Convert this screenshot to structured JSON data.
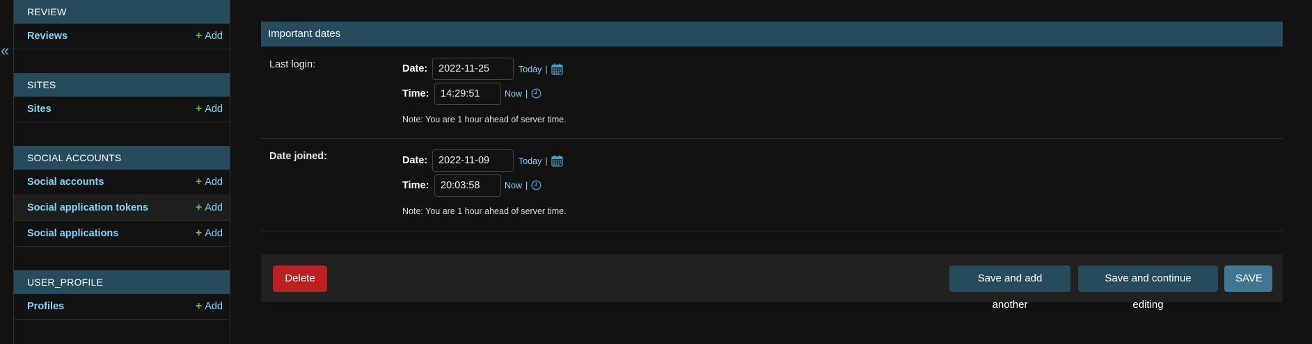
{
  "sidebar": {
    "collapse_glyph": "«",
    "modules": [
      {
        "title": "REVIEW",
        "items": [
          {
            "label": "Reviews",
            "add": "Add"
          }
        ]
      },
      {
        "title": "SITES",
        "items": [
          {
            "label": "Sites",
            "add": "Add"
          }
        ]
      },
      {
        "title": "SOCIAL ACCOUNTS",
        "items": [
          {
            "label": "Social accounts",
            "add": "Add"
          },
          {
            "label": "Social application tokens",
            "add": "Add"
          },
          {
            "label": "Social applications",
            "add": "Add"
          }
        ]
      },
      {
        "title": "USER_PROFILE",
        "items": [
          {
            "label": "Profiles",
            "add": "Add"
          }
        ]
      }
    ]
  },
  "fieldset": {
    "title": "Important dates",
    "last_login": {
      "label": "Last login:",
      "date_label": "Date:",
      "date_value": "2022-11-25",
      "today": "Today",
      "time_label": "Time:",
      "time_value": "14:29:51",
      "now": "Now",
      "note": "Note: You are 1 hour ahead of server time."
    },
    "date_joined": {
      "label": "Date joined:",
      "date_label": "Date:",
      "date_value": "2022-11-09",
      "today": "Today",
      "time_label": "Time:",
      "time_value": "20:03:58",
      "now": "Now",
      "note": "Note: You are 1 hour ahead of server time."
    },
    "separator": "|"
  },
  "actions": {
    "delete": "Delete",
    "save_add_another": "Save and add another",
    "save_continue": "Save and continue editing",
    "save": "SAVE"
  },
  "colors": {
    "background": "#121212",
    "header": "#264b5d",
    "link": "#81d4fa",
    "add_plus": "#70bf2b",
    "delete": "#ba2121",
    "save": "#417690"
  }
}
